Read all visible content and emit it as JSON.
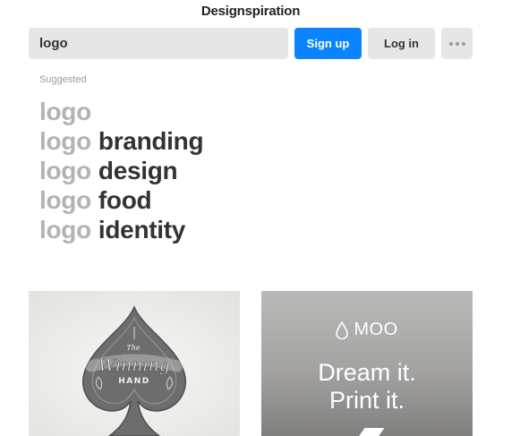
{
  "header": {
    "brand": "Designspiration"
  },
  "search": {
    "value": "logo"
  },
  "actions": {
    "signup_label": "Sign up",
    "login_label": "Log in",
    "more_icon": "ellipsis-icon"
  },
  "suggested": {
    "label": "Suggested",
    "items": [
      {
        "prefix": "logo",
        "suffix": ""
      },
      {
        "prefix": "logo",
        "suffix": "branding"
      },
      {
        "prefix": "logo",
        "suffix": "design"
      },
      {
        "prefix": "logo",
        "suffix": "food"
      },
      {
        "prefix": "logo",
        "suffix": "identity"
      }
    ]
  },
  "cards": [
    {
      "image_icon": "spade-icon",
      "lettering": "The Winning Hand"
    },
    {
      "brand": "MOO",
      "brand_icon": "drop-icon",
      "tagline_1": "Dream it.",
      "tagline_2": "Print it."
    }
  ],
  "colors": {
    "primary": "#0b84ff",
    "button_bg": "#e6e6e6",
    "suggest_prefix": "#b3b3b3",
    "suggest_suffix": "#333333"
  }
}
